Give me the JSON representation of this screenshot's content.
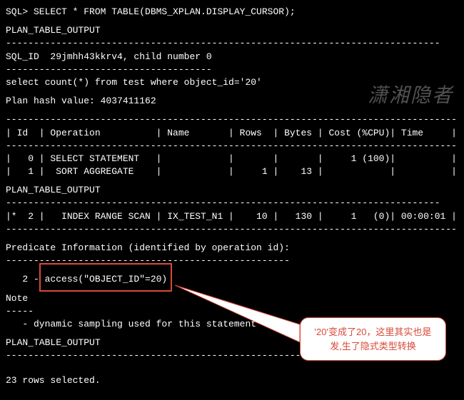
{
  "prompt": "SQL> SELECT * FROM TABLE(DBMS_XPLAN.DISPLAY_CURSOR);",
  "header1": "PLAN_TABLE_OUTPUT",
  "sep1": "------------------------------------------------------------------------------",
  "sql_id_line": "SQL_ID  29jmhh43kkrv4, child number 0",
  "sql_id_sep": "-------------------------------------",
  "sql_text": "select count(*) from test where object_id='20'",
  "plan_hash": "Plan hash value: 4037411162",
  "tbl_border": "---------------------------------------------------------------------------------",
  "tbl_header": "| Id  | Operation          | Name       | Rows  | Bytes | Cost (%CPU)| Time     |",
  "tbl_row0": "|   0 | SELECT STATEMENT   |            |       |       |     1 (100)|          |",
  "tbl_row1": "|   1 |  SORT AGGREGATE    |            |     1 |    13 |            |          |",
  "header2": "PLAN_TABLE_OUTPUT",
  "sep2": "------------------------------------------------------------------------------",
  "tbl_row2": "|*  2 |   INDEX RANGE SCAN | IX_TEST_N1 |    10 |   130 |     1   (0)| 00:00:01 |",
  "tbl_border2": "---------------------------------------------------------------------------------",
  "pred_header": "Predicate Information (identified by operation id):",
  "pred_sep": "---------------------------------------------------",
  "pred_line": "   2 - access(\"OBJECT_ID\"=20)",
  "note_header": "Note",
  "note_sep": "-----",
  "note_line": "   - dynamic sampling used for this statement",
  "header3": "PLAN_TABLE_OUTPUT",
  "sep3": "------------------------------------------------------------------------------",
  "rows_selected": "23 rows selected.",
  "watermark": "潇湘隐者",
  "callout": "'20'变成了20，这里其实也是发,生了隐式类型转换"
}
